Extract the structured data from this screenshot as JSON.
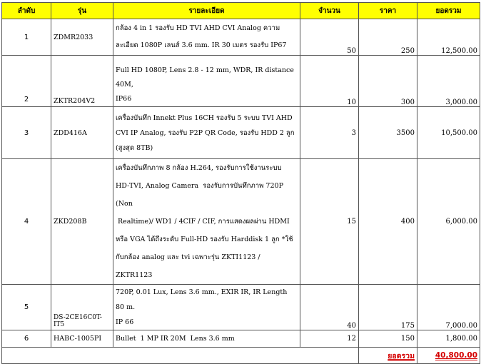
{
  "headers": {
    "no": "ลำดับ",
    "model": "รุ่น",
    "desc": "รายละเอียด",
    "qty": "จำนวน",
    "price": "ราคา",
    "total": "ยอดรวม"
  },
  "rows": [
    {
      "no": "1",
      "model": "ZDMR2033",
      "desc": "กล้อง 4 in 1 รองรับ HD TVI AHD CVI Analog ความ\nละเอียด 1080P เลนส์ 3.6 mm. IR 30 เมตร รองรับ IP67",
      "qty": "50",
      "price": "250",
      "total": "12,500.00"
    },
    {
      "no": "2",
      "model": "ZKTR204V2",
      "desc": "Full HD 1080P, Lens 2.8 - 12 mm, WDR, IR distance 40M,\nIP66",
      "qty": "10",
      "price": "300",
      "total": "3,000.00"
    },
    {
      "no": "3",
      "model": "ZDD416A",
      "desc": "เครื่องบันทึก Innekt Plus 16CH รองรับ 5 ระบบ TVI AHD\nCVI IP Analog, รองรับ P2P QR Code, รองรับ HDD 2 ลูก\n(สูงสุด 8TB)",
      "qty": "3",
      "price": "3500",
      "total": "10,500.00"
    },
    {
      "no": "4",
      "model": "ZKD208B",
      "desc": "เครื่องบันทึกภาพ 8 กล้อง H.264, รองรับการใช้งานระบบ\nHD-TVI, Analog Camera  รองรับการบันทึกภาพ 720P (Non\n Realtime)/ WD1 / 4CIF / CIF, การแสดงผลผ่าน HDMI\nหรือ VGA ได้ถึงระดับ Full-HD รองรับ Harddisk 1 ลูก *ใช้\nกับกล้อง analog และ tvi เฉพาะรุ่น ZKTI1123 / ZKTR1123",
      "qty": "15",
      "price": "400",
      "total": "6,000.00"
    },
    {
      "no": "5",
      "model": "DS-2CE16C0T-IT5",
      "desc": "720P, 0.01 Lux, Lens 3.6 mm., EXIR IR, IR Length 80 m.\nIP 66",
      "qty": "40",
      "price": "175",
      "total": "7,000.00"
    },
    {
      "no": "6",
      "model": "HABC-1005PI",
      "desc": "Bullet  1 MP IR 20M  Lens 3.6 mm",
      "qty": "12",
      "price": "150",
      "total": "1,800.00"
    }
  ],
  "footer": {
    "label": "ยอดรวม",
    "value": "40,800.00"
  }
}
